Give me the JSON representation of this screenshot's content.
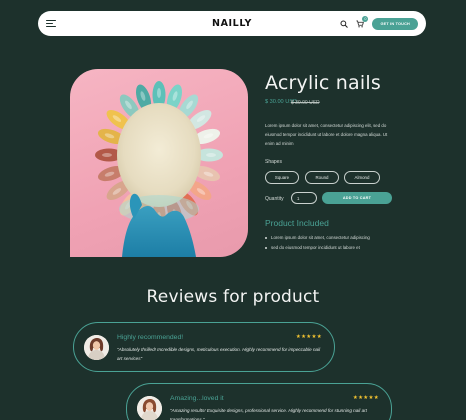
{
  "header": {
    "logo": "NAILLY",
    "cta_label": "GET IN TOUCH",
    "cart_count": "0",
    "icons": [
      "menu-icon",
      "search-icon",
      "cart-icon"
    ]
  },
  "product": {
    "title": "Acrylic nails",
    "price": "$ 30.00 USD",
    "old_price": "$ 39.00 USD",
    "description": "Lorem ipsum dolor sit amet, consectetur adipiscing elit, sed do eiusmod tempor incididunt ut labore et dolore magna aliqua. Ut enim ad minim",
    "shapes_label": "Shapes",
    "shapes": [
      "Square",
      "Round",
      "Almond"
    ],
    "quantity_label": "Quantity",
    "quantity_value": "1",
    "add_to_cart_label": "ADD TO CART",
    "included_title": "Product Included",
    "included_items": [
      "Lorem ipsum dolor sit amet, consectetur adipiscing",
      "sed do eiusmod tempor incididunt ut labore et"
    ]
  },
  "reviews": {
    "heading": "Reviews for product",
    "items": [
      {
        "title": "Highly recommended!",
        "text": "\"Absolutely thrilled! Incredible designs, meticulous execution. Highly recommend for impeccable nail art services\"",
        "stars": "★★★★★"
      },
      {
        "title": "Amazing...loved it",
        "text": "\"Amazing results! Exquisite designs, professional service. Highly recommend for stunning nail art transformations.\"",
        "stars": "★★★★★"
      }
    ]
  },
  "colors": {
    "background": "#1d312c",
    "accent": "#4aa295",
    "star": "#f2c230",
    "header_bg": "#ffffff"
  }
}
